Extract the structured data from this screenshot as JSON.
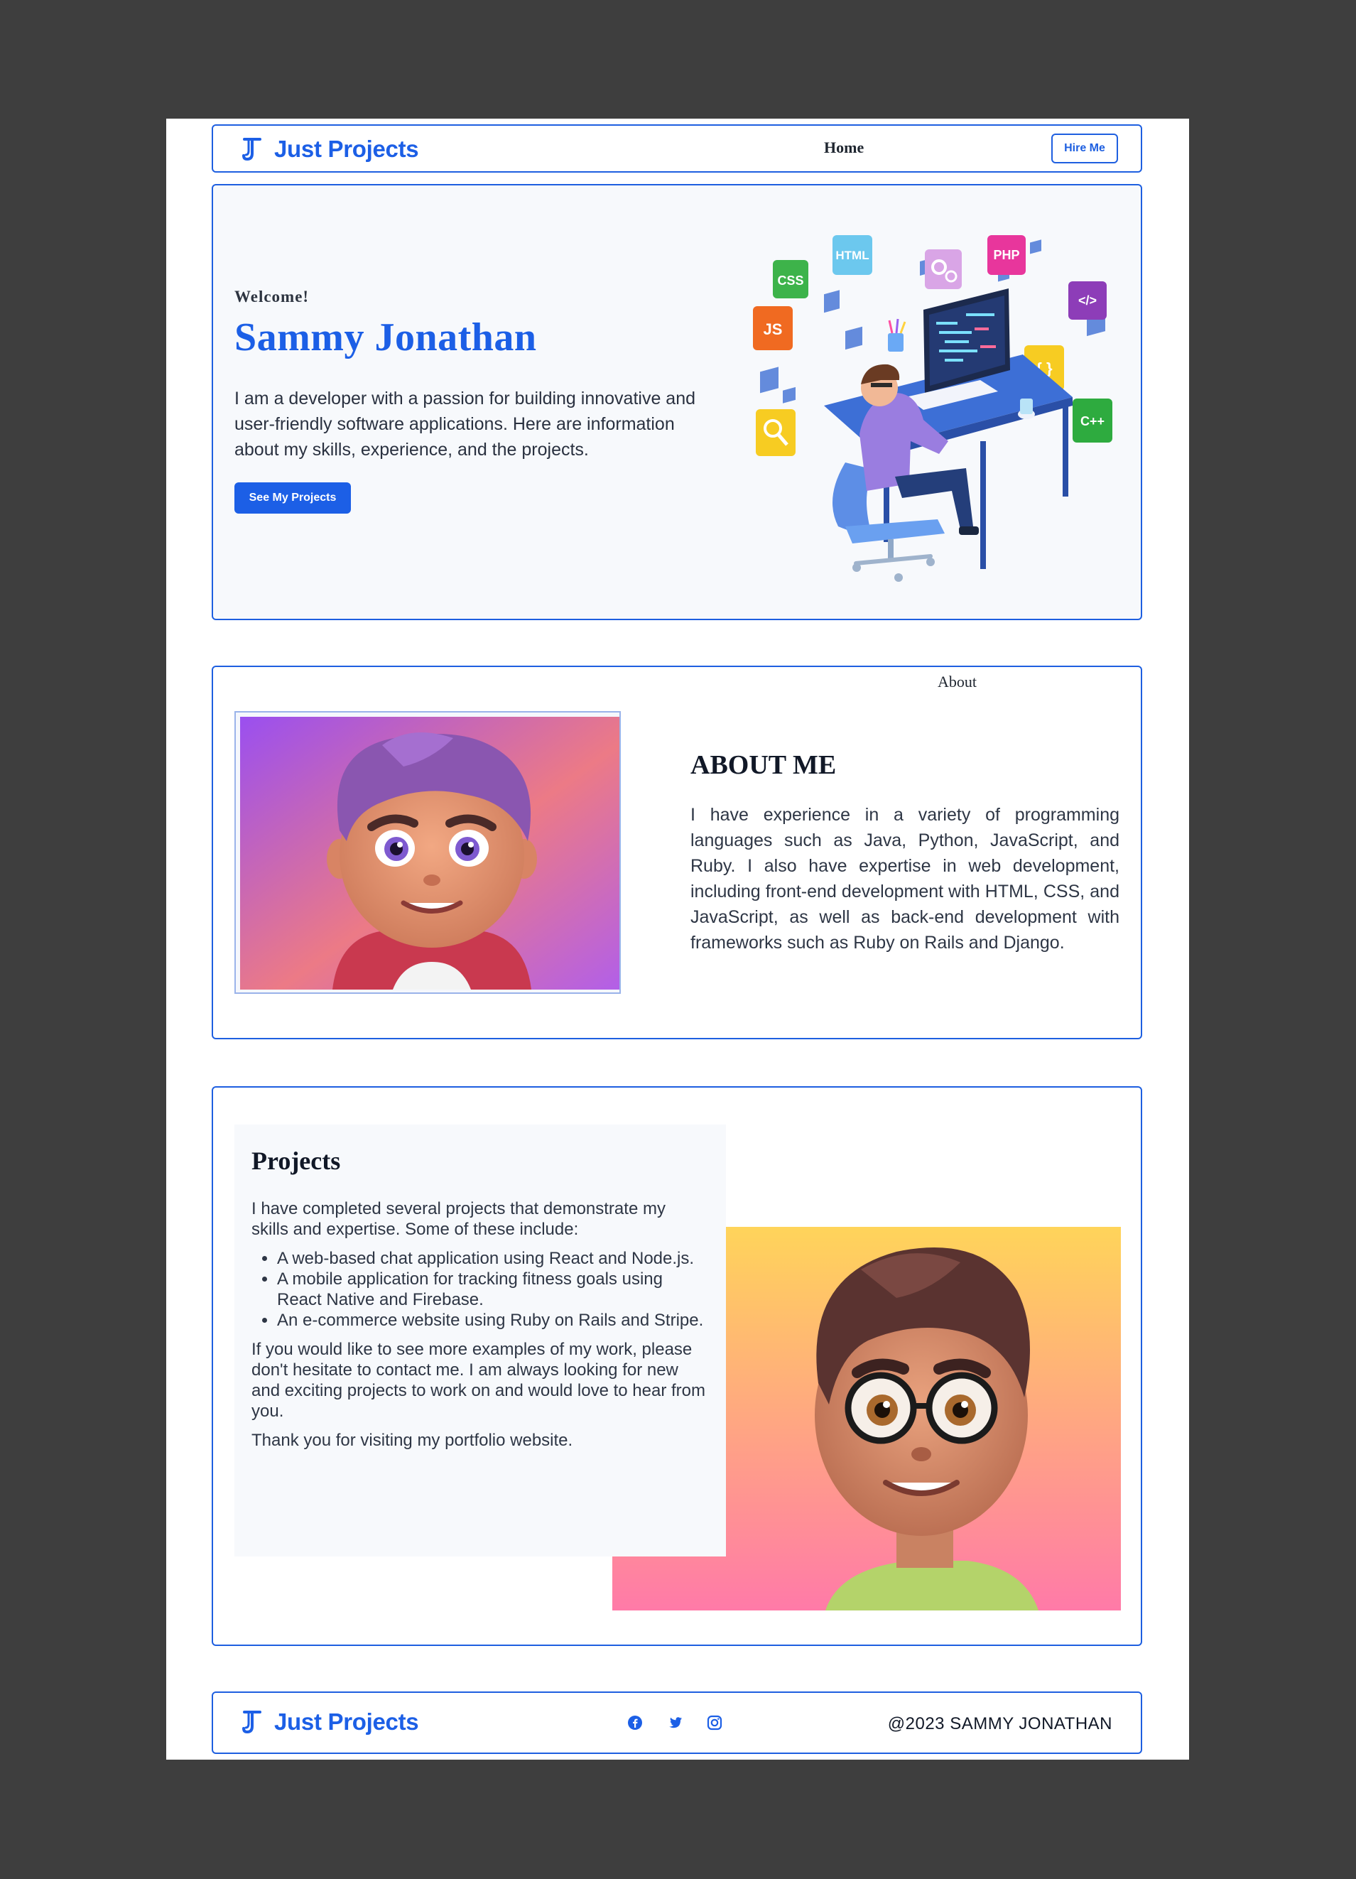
{
  "brand": {
    "name": "Just Projects"
  },
  "nav": {
    "home": "Home",
    "about": "About",
    "hire": "Hire Me"
  },
  "hero": {
    "welcome": "Welcome!",
    "name": "Sammy Jonathan",
    "intro": "I am a developer with a passion for building innovative and user-friendly software applications. Here are information about my skills, experience, and the projects.",
    "cta": "See My Projects",
    "badges": [
      "CSS",
      "HTML",
      "PHP",
      "JS",
      "{ }",
      "C++",
      "</>"
    ]
  },
  "about": {
    "title": "ABOUT ME",
    "text": "I have experience in a variety of programming languages such as Java, Python, JavaScript, and Ruby. I also have expertise in web development, including front-end development with HTML, CSS, and JavaScript, as well as back-end development with frameworks such as Ruby on Rails and Django."
  },
  "projects": {
    "title": "Projects",
    "intro": "I have completed several projects that demonstrate my skills and expertise. Some of these include:",
    "items": [
      "A web-based chat application using React and Node.js.",
      "A mobile application for tracking fitness goals using React Native and Firebase.",
      "An e-commerce website using Ruby on Rails and Stripe."
    ],
    "outro": "If you would like to see more examples of my work, please don't hesitate to contact me. I am always looking for new and exciting projects to work on and would love to hear from you.",
    "thanks": "Thank you for visiting my portfolio website."
  },
  "footer": {
    "copyright": "@2023 SAMMY JONATHAN",
    "social": [
      "facebook-icon",
      "twitter-icon",
      "instagram-icon"
    ]
  },
  "colors": {
    "accent": "#1c5fe6",
    "border": "#1e5fe0",
    "backdrop": "#3e3e3e",
    "card": "#f7f9fc"
  }
}
